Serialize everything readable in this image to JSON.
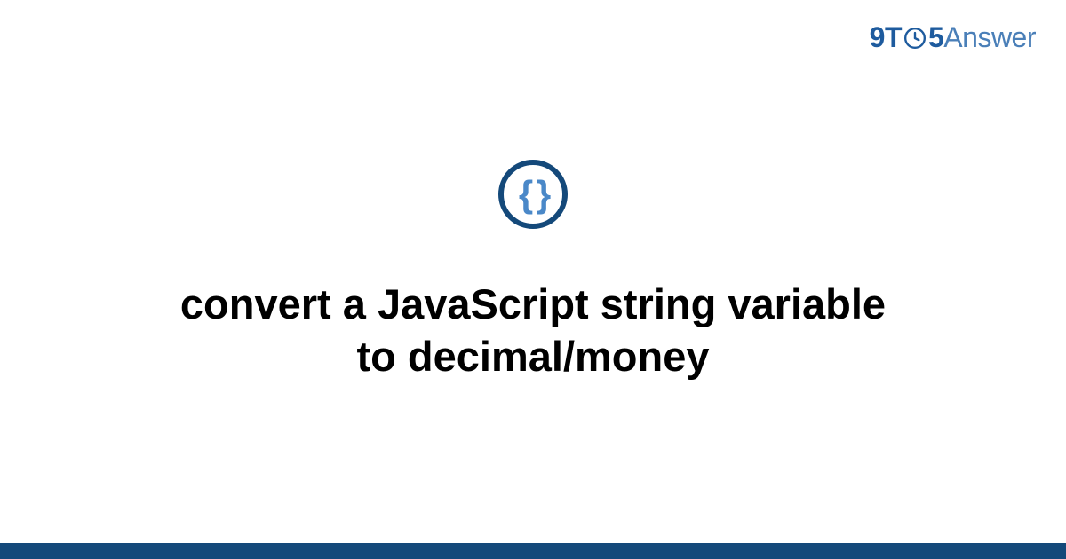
{
  "logo": {
    "part1": "9",
    "part2": "T",
    "part3": "5",
    "part4": "Answer"
  },
  "category": {
    "icon_name": "code-braces",
    "icon_glyph": "{ }"
  },
  "title": "convert a JavaScript string variable to decimal/money",
  "colors": {
    "brand_dark": "#14497a",
    "brand_light": "#4a88c8",
    "logo_primary": "#1e5b9e",
    "logo_secondary": "#4a7fb8"
  }
}
